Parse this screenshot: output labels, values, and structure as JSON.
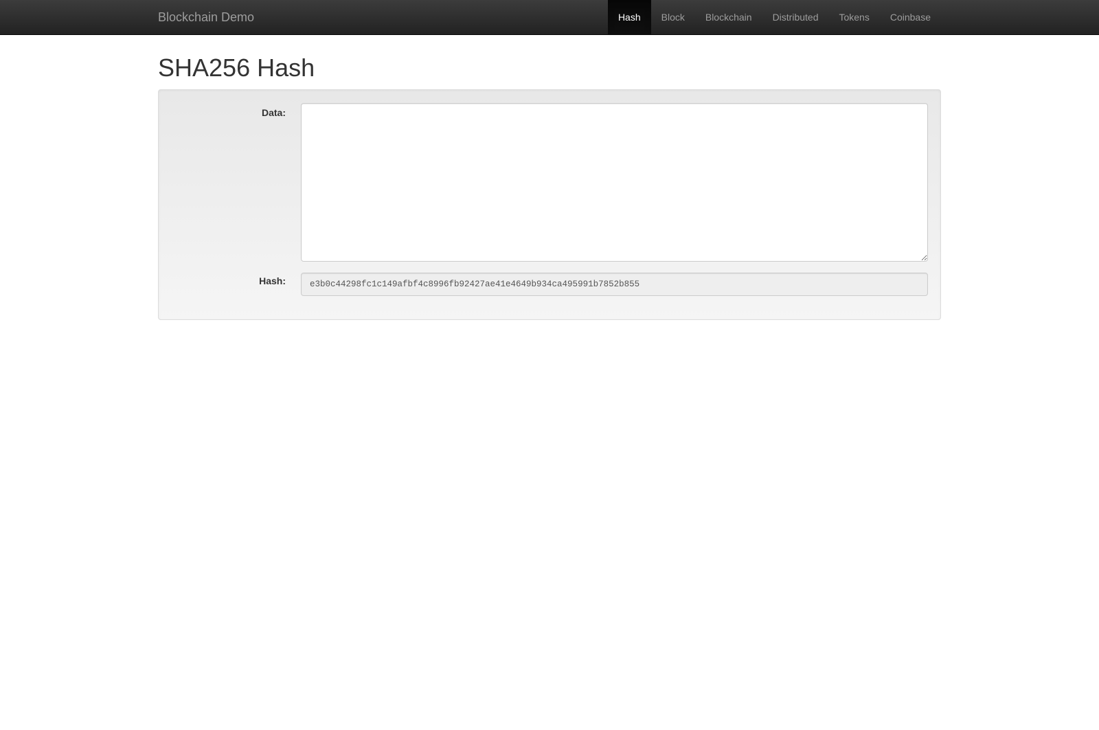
{
  "navbar": {
    "brand": "Blockchain Demo",
    "items": [
      {
        "label": "Hash",
        "active": true
      },
      {
        "label": "Block",
        "active": false
      },
      {
        "label": "Blockchain",
        "active": false
      },
      {
        "label": "Distributed",
        "active": false
      },
      {
        "label": "Tokens",
        "active": false
      },
      {
        "label": "Coinbase",
        "active": false
      }
    ]
  },
  "page": {
    "title": "SHA256 Hash"
  },
  "form": {
    "data_label": "Data:",
    "data_value": "",
    "hash_label": "Hash:",
    "hash_value": "e3b0c44298fc1c149afbf4c8996fb92427ae41e4649b934ca495991b7852b855"
  }
}
